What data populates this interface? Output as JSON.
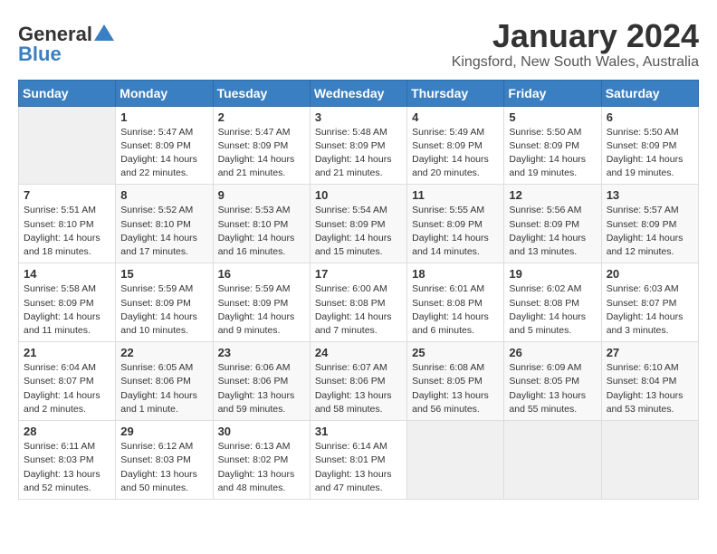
{
  "logo": {
    "general": "General",
    "blue": "Blue"
  },
  "title": {
    "month": "January 2024",
    "location": "Kingsford, New South Wales, Australia"
  },
  "weekdays": [
    "Sunday",
    "Monday",
    "Tuesday",
    "Wednesday",
    "Thursday",
    "Friday",
    "Saturday"
  ],
  "weeks": [
    [
      {
        "day": "",
        "info": ""
      },
      {
        "day": "1",
        "info": "Sunrise: 5:47 AM\nSunset: 8:09 PM\nDaylight: 14 hours\nand 22 minutes."
      },
      {
        "day": "2",
        "info": "Sunrise: 5:47 AM\nSunset: 8:09 PM\nDaylight: 14 hours\nand 21 minutes."
      },
      {
        "day": "3",
        "info": "Sunrise: 5:48 AM\nSunset: 8:09 PM\nDaylight: 14 hours\nand 21 minutes."
      },
      {
        "day": "4",
        "info": "Sunrise: 5:49 AM\nSunset: 8:09 PM\nDaylight: 14 hours\nand 20 minutes."
      },
      {
        "day": "5",
        "info": "Sunrise: 5:50 AM\nSunset: 8:09 PM\nDaylight: 14 hours\nand 19 minutes."
      },
      {
        "day": "6",
        "info": "Sunrise: 5:50 AM\nSunset: 8:09 PM\nDaylight: 14 hours\nand 19 minutes."
      }
    ],
    [
      {
        "day": "7",
        "info": "Sunrise: 5:51 AM\nSunset: 8:10 PM\nDaylight: 14 hours\nand 18 minutes."
      },
      {
        "day": "8",
        "info": "Sunrise: 5:52 AM\nSunset: 8:10 PM\nDaylight: 14 hours\nand 17 minutes."
      },
      {
        "day": "9",
        "info": "Sunrise: 5:53 AM\nSunset: 8:10 PM\nDaylight: 14 hours\nand 16 minutes."
      },
      {
        "day": "10",
        "info": "Sunrise: 5:54 AM\nSunset: 8:09 PM\nDaylight: 14 hours\nand 15 minutes."
      },
      {
        "day": "11",
        "info": "Sunrise: 5:55 AM\nSunset: 8:09 PM\nDaylight: 14 hours\nand 14 minutes."
      },
      {
        "day": "12",
        "info": "Sunrise: 5:56 AM\nSunset: 8:09 PM\nDaylight: 14 hours\nand 13 minutes."
      },
      {
        "day": "13",
        "info": "Sunrise: 5:57 AM\nSunset: 8:09 PM\nDaylight: 14 hours\nand 12 minutes."
      }
    ],
    [
      {
        "day": "14",
        "info": "Sunrise: 5:58 AM\nSunset: 8:09 PM\nDaylight: 14 hours\nand 11 minutes."
      },
      {
        "day": "15",
        "info": "Sunrise: 5:59 AM\nSunset: 8:09 PM\nDaylight: 14 hours\nand 10 minutes."
      },
      {
        "day": "16",
        "info": "Sunrise: 5:59 AM\nSunset: 8:09 PM\nDaylight: 14 hours\nand 9 minutes."
      },
      {
        "day": "17",
        "info": "Sunrise: 6:00 AM\nSunset: 8:08 PM\nDaylight: 14 hours\nand 7 minutes."
      },
      {
        "day": "18",
        "info": "Sunrise: 6:01 AM\nSunset: 8:08 PM\nDaylight: 14 hours\nand 6 minutes."
      },
      {
        "day": "19",
        "info": "Sunrise: 6:02 AM\nSunset: 8:08 PM\nDaylight: 14 hours\nand 5 minutes."
      },
      {
        "day": "20",
        "info": "Sunrise: 6:03 AM\nSunset: 8:07 PM\nDaylight: 14 hours\nand 3 minutes."
      }
    ],
    [
      {
        "day": "21",
        "info": "Sunrise: 6:04 AM\nSunset: 8:07 PM\nDaylight: 14 hours\nand 2 minutes."
      },
      {
        "day": "22",
        "info": "Sunrise: 6:05 AM\nSunset: 8:06 PM\nDaylight: 14 hours\nand 1 minute."
      },
      {
        "day": "23",
        "info": "Sunrise: 6:06 AM\nSunset: 8:06 PM\nDaylight: 13 hours\nand 59 minutes."
      },
      {
        "day": "24",
        "info": "Sunrise: 6:07 AM\nSunset: 8:06 PM\nDaylight: 13 hours\nand 58 minutes."
      },
      {
        "day": "25",
        "info": "Sunrise: 6:08 AM\nSunset: 8:05 PM\nDaylight: 13 hours\nand 56 minutes."
      },
      {
        "day": "26",
        "info": "Sunrise: 6:09 AM\nSunset: 8:05 PM\nDaylight: 13 hours\nand 55 minutes."
      },
      {
        "day": "27",
        "info": "Sunrise: 6:10 AM\nSunset: 8:04 PM\nDaylight: 13 hours\nand 53 minutes."
      }
    ],
    [
      {
        "day": "28",
        "info": "Sunrise: 6:11 AM\nSunset: 8:03 PM\nDaylight: 13 hours\nand 52 minutes."
      },
      {
        "day": "29",
        "info": "Sunrise: 6:12 AM\nSunset: 8:03 PM\nDaylight: 13 hours\nand 50 minutes."
      },
      {
        "day": "30",
        "info": "Sunrise: 6:13 AM\nSunset: 8:02 PM\nDaylight: 13 hours\nand 48 minutes."
      },
      {
        "day": "31",
        "info": "Sunrise: 6:14 AM\nSunset: 8:01 PM\nDaylight: 13 hours\nand 47 minutes."
      },
      {
        "day": "",
        "info": ""
      },
      {
        "day": "",
        "info": ""
      },
      {
        "day": "",
        "info": ""
      }
    ]
  ]
}
